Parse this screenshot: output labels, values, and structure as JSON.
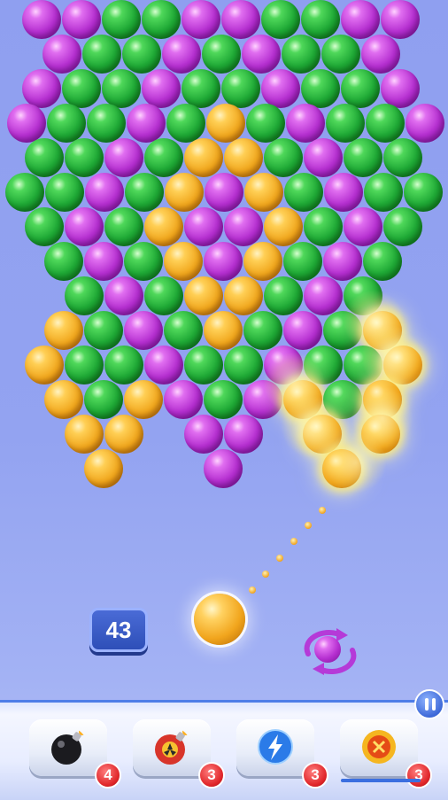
{
  "game": {
    "moves_left": "43",
    "current_bubble": "gold",
    "next_bubble": "purple"
  },
  "board": {
    "rows": [
      [
        "purple",
        "purple",
        "green",
        "green",
        "purple",
        "purple",
        "green",
        "green",
        "purple",
        "purple"
      ],
      [
        "purple",
        "green",
        "green",
        "purple",
        "green",
        "purple",
        "green",
        "green",
        "purple"
      ],
      [
        "purple",
        "green",
        "green",
        "purple",
        "green",
        "green",
        "purple",
        "green",
        "green",
        "purple"
      ],
      [
        "purple",
        "green",
        "green",
        "purple",
        "green",
        "gold",
        "green",
        "purple",
        "green",
        "green",
        "purple"
      ],
      [
        "green",
        "green",
        "purple",
        "green",
        "gold",
        "gold",
        "green",
        "purple",
        "green",
        "green"
      ],
      [
        "green",
        "green",
        "purple",
        "green",
        "gold",
        "purple",
        "gold",
        "green",
        "purple",
        "green",
        "green"
      ],
      [
        "green",
        "purple",
        "green",
        "gold",
        "purple",
        "purple",
        "gold",
        "green",
        "purple",
        "green"
      ],
      [
        "green",
        "purple",
        "green",
        "gold",
        "purple",
        "gold",
        "green",
        "purple",
        "green"
      ],
      [
        "green",
        "purple",
        "green",
        "gold",
        "gold",
        "green",
        "purple",
        "green"
      ],
      [
        "gold",
        "green",
        "purple",
        "green",
        "gold",
        "green",
        "purple",
        "green",
        "gold"
      ],
      [
        "gold",
        "green",
        "green",
        "purple",
        "green",
        "green",
        "purple",
        "green",
        "green",
        "gold"
      ],
      [
        "gold",
        "green",
        "gold",
        "purple",
        "green",
        "purple",
        "gold",
        "green",
        "gold"
      ],
      [
        "gold",
        "gold",
        "purple",
        "purple",
        "gold",
        "gold"
      ],
      [
        "gold",
        "purple",
        "gold"
      ]
    ]
  },
  "boosters": [
    {
      "name": "bomb",
      "icon": "bomb-icon",
      "count": "4"
    },
    {
      "name": "fire-bomb",
      "icon": "fire-bomb-icon",
      "count": "3"
    },
    {
      "name": "lightning",
      "icon": "lightning-ball-icon",
      "count": "3"
    },
    {
      "name": "fireball",
      "icon": "fireball-icon",
      "count": "3"
    }
  ],
  "icons": {
    "pause": "pause-icon",
    "swap": "swap-arrows-icon"
  }
}
